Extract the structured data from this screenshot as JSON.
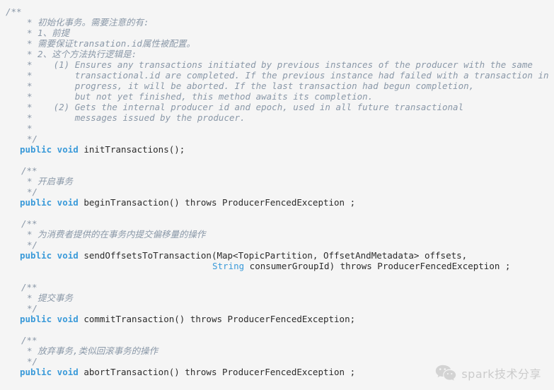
{
  "editor": {
    "language": "java",
    "background_color": "#f5f5f5",
    "comment_color": "#8a98a8",
    "keyword_color": "#3a9ad9",
    "text_color": "#2b2b2b"
  },
  "code_lines": [
    {
      "indent": 8,
      "tokens": [
        {
          "t": "cmt",
          "v": "/**"
        }
      ]
    },
    {
      "indent": 38,
      "tokens": [
        {
          "t": "cmt",
          "v": "* 初始化事务。需要注意的有:"
        }
      ]
    },
    {
      "indent": 38,
      "tokens": [
        {
          "t": "cmt",
          "v": "* 1、前提"
        }
      ]
    },
    {
      "indent": 38,
      "tokens": [
        {
          "t": "cmt",
          "v": "* 需要保证transation.id属性被配置。"
        }
      ]
    },
    {
      "indent": 38,
      "tokens": [
        {
          "t": "cmt",
          "v": "* 2、这个方法执行逻辑是:"
        }
      ]
    },
    {
      "indent": 38,
      "tokens": [
        {
          "t": "cmt",
          "v": "*    (1) Ensures any transactions initiated by previous instances of the producer with the same"
        }
      ]
    },
    {
      "indent": 38,
      "tokens": [
        {
          "t": "cmt",
          "v": "*        transactional.id are completed. If the previous instance had failed with a transaction in"
        }
      ]
    },
    {
      "indent": 38,
      "tokens": [
        {
          "t": "cmt",
          "v": "*        progress, it will be aborted. If the last transaction had begun completion,"
        }
      ]
    },
    {
      "indent": 38,
      "tokens": [
        {
          "t": "cmt",
          "v": "*        but not yet finished, this method awaits its completion."
        }
      ]
    },
    {
      "indent": 38,
      "tokens": [
        {
          "t": "cmt",
          "v": "*    (2) Gets the internal producer id and epoch, used in all future transactional"
        }
      ]
    },
    {
      "indent": 38,
      "tokens": [
        {
          "t": "cmt",
          "v": "*        messages issued by the producer."
        }
      ]
    },
    {
      "indent": 38,
      "tokens": [
        {
          "t": "cmt",
          "v": "*"
        }
      ]
    },
    {
      "indent": 38,
      "tokens": [
        {
          "t": "cmt",
          "v": "*/"
        }
      ]
    },
    {
      "indent": 28,
      "tokens": [
        {
          "t": "kw",
          "v": "public void"
        },
        {
          "t": "plain",
          "v": " initTransactions();"
        }
      ]
    },
    {
      "indent": 0,
      "tokens": []
    },
    {
      "indent": 30,
      "tokens": [
        {
          "t": "cmt",
          "v": "/**"
        }
      ]
    },
    {
      "indent": 38,
      "tokens": [
        {
          "t": "cmt",
          "v": "* 开启事务"
        }
      ]
    },
    {
      "indent": 38,
      "tokens": [
        {
          "t": "cmt",
          "v": "*/"
        }
      ]
    },
    {
      "indent": 28,
      "tokens": [
        {
          "t": "kw",
          "v": "public void"
        },
        {
          "t": "plain",
          "v": " beginTransaction() throws ProducerFencedException ;"
        }
      ]
    },
    {
      "indent": 0,
      "tokens": []
    },
    {
      "indent": 30,
      "tokens": [
        {
          "t": "cmt",
          "v": "/**"
        }
      ]
    },
    {
      "indent": 38,
      "tokens": [
        {
          "t": "cmt",
          "v": "* 为消费者提供的在事务内提交偏移量的操作"
        }
      ]
    },
    {
      "indent": 38,
      "tokens": [
        {
          "t": "cmt",
          "v": "*/"
        }
      ]
    },
    {
      "indent": 28,
      "tokens": [
        {
          "t": "kw",
          "v": "public void"
        },
        {
          "t": "plain",
          "v": " sendOffsetsToTransaction(Map<TopicPartition, OffsetAndMetadata> offsets,"
        }
      ]
    },
    {
      "indent": 300,
      "tokens": [
        {
          "t": "type",
          "v": "String"
        },
        {
          "t": "plain",
          "v": " consumerGroupId) throws ProducerFencedException ;"
        }
      ]
    },
    {
      "indent": 0,
      "tokens": []
    },
    {
      "indent": 30,
      "tokens": [
        {
          "t": "cmt",
          "v": "/**"
        }
      ]
    },
    {
      "indent": 38,
      "tokens": [
        {
          "t": "cmt",
          "v": "* 提交事务"
        }
      ]
    },
    {
      "indent": 38,
      "tokens": [
        {
          "t": "cmt",
          "v": "*/"
        }
      ]
    },
    {
      "indent": 28,
      "tokens": [
        {
          "t": "kw",
          "v": "public void"
        },
        {
          "t": "plain",
          "v": " commitTransaction() throws ProducerFencedException;"
        }
      ]
    },
    {
      "indent": 0,
      "tokens": []
    },
    {
      "indent": 30,
      "tokens": [
        {
          "t": "cmt",
          "v": "/**"
        }
      ]
    },
    {
      "indent": 38,
      "tokens": [
        {
          "t": "cmt",
          "v": "* 放弃事务,类似回滚事务的操作"
        }
      ]
    },
    {
      "indent": 38,
      "tokens": [
        {
          "t": "cmt",
          "v": "*/"
        }
      ]
    },
    {
      "indent": 28,
      "tokens": [
        {
          "t": "kw",
          "v": "public void"
        },
        {
          "t": "plain",
          "v": " abortTransaction() throws ProducerFencedException ;"
        }
      ]
    }
  ],
  "watermark": {
    "icon": "wechat-icon",
    "text": "spark技术分享",
    "color": "#c9c9c9"
  }
}
